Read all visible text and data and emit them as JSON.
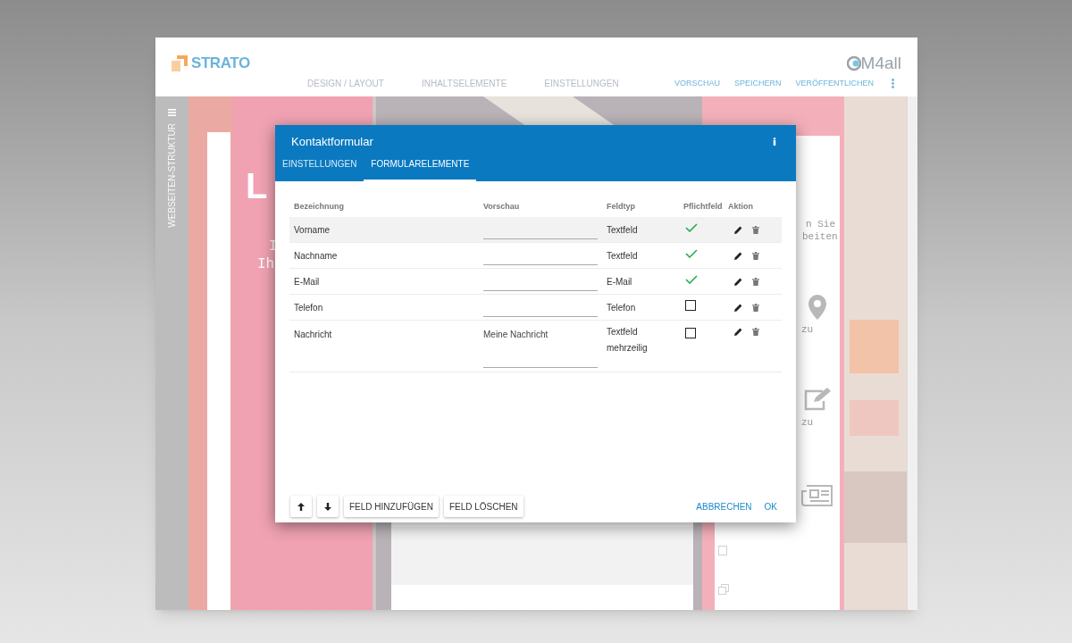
{
  "header": {
    "logo": "STRATO",
    "brand": "M4all",
    "nav": [
      {
        "label": "DESIGN / LAYOUT"
      },
      {
        "label": "INHALTSELEMENTE"
      },
      {
        "label": "EINSTELLUNGEN"
      }
    ],
    "actions": [
      "VORSCHAU",
      "SPEICHERN",
      "VERÖFFENTLICHEN"
    ]
  },
  "sidebar": {
    "title": "WEBSEITEN-STRUKTUR"
  },
  "page_texts": [
    {
      "text": "L",
      "kind": "heading"
    },
    {
      "text": "I",
      "kind": "line_a"
    },
    {
      "text": "Ih",
      "kind": "line_b"
    },
    {
      "text": "n Sie",
      "kind": "side_a"
    },
    {
      "text": "beiten",
      "kind": "side_b"
    },
    {
      "text": "zu",
      "kind": "side_c"
    },
    {
      "text": "zu",
      "kind": "side_d"
    }
  ],
  "dialog": {
    "title": "Kontaktformular",
    "tabs": [
      {
        "label": "EINSTELLUNGEN",
        "selected": false
      },
      {
        "label": "FORMULARELEMENTE",
        "selected": true
      }
    ],
    "columns": [
      "Bezeichnung",
      "Vorschau",
      "Feldtyp",
      "Pflichtfeld",
      "Aktion"
    ],
    "rows": [
      {
        "label": "Vorname",
        "kind": "single",
        "type": "Textfeld",
        "required": true,
        "selected": true
      },
      {
        "label": "Nachname",
        "kind": "single",
        "type": "Textfeld",
        "required": true,
        "selected": false
      },
      {
        "label": "E-Mail",
        "kind": "single",
        "type": "E-Mail",
        "required": true,
        "selected": false
      },
      {
        "label": "Telefon",
        "kind": "single",
        "type": "Telefon",
        "required": false,
        "selected": false
      },
      {
        "label": "Nachricht",
        "kind": "multi",
        "preview": "Meine Nachricht",
        "type": "Textfeld mehrzeilig",
        "required": false,
        "selected": false
      }
    ],
    "buttons": [
      "FELD HINZUFÜGEN",
      "FELD LÖSCHEN"
    ],
    "actions": [
      "ABBRECHEN",
      "OK"
    ]
  }
}
